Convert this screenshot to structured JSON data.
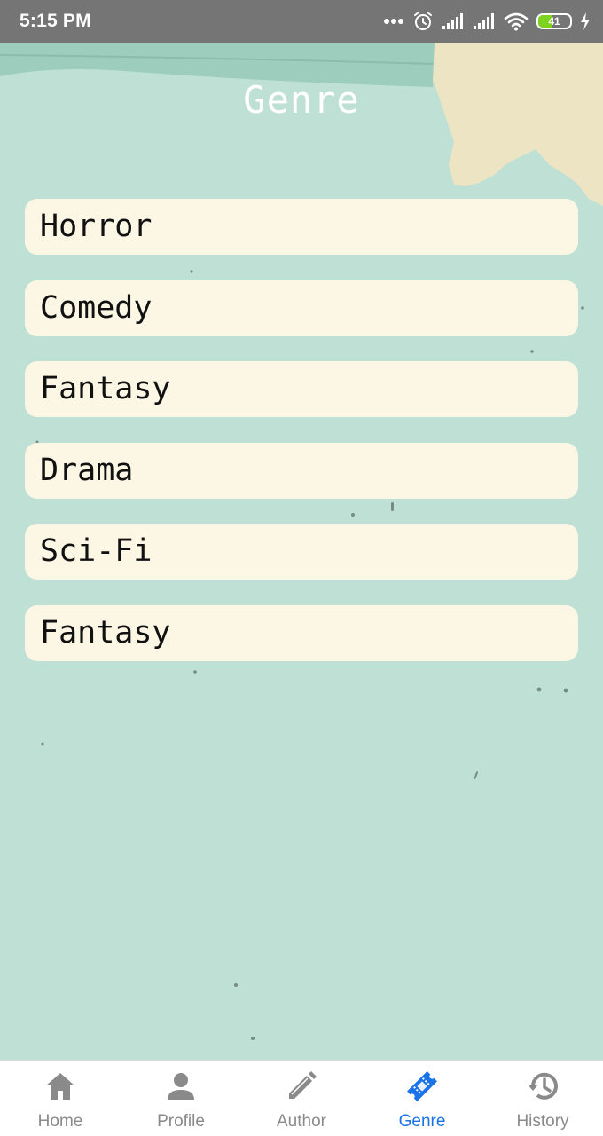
{
  "status_bar": {
    "time": "5:15 PM",
    "battery_level": "41",
    "battery_fraction": 0.41
  },
  "header": {
    "title": "Genre"
  },
  "genres": [
    {
      "label": "Horror"
    },
    {
      "label": "Comedy"
    },
    {
      "label": "Fantasy"
    },
    {
      "label": "Drama"
    },
    {
      "label": "Sci-Fi"
    },
    {
      "label": "Fantasy"
    }
  ],
  "bottom_nav": {
    "items": [
      {
        "label": "Home",
        "icon": "home-icon"
      },
      {
        "label": "Profile",
        "icon": "person-icon"
      },
      {
        "label": "Author",
        "icon": "pencil-icon"
      },
      {
        "label": "Genre",
        "icon": "ticket-icon"
      },
      {
        "label": "History",
        "icon": "history-icon"
      }
    ],
    "active_index": 3
  },
  "colors": {
    "background": "#bfe0d5",
    "card": "#fcf6e4",
    "accent": "#1a73e8",
    "nav_inactive": "#8a8a8a",
    "status_bar": "#757575"
  }
}
